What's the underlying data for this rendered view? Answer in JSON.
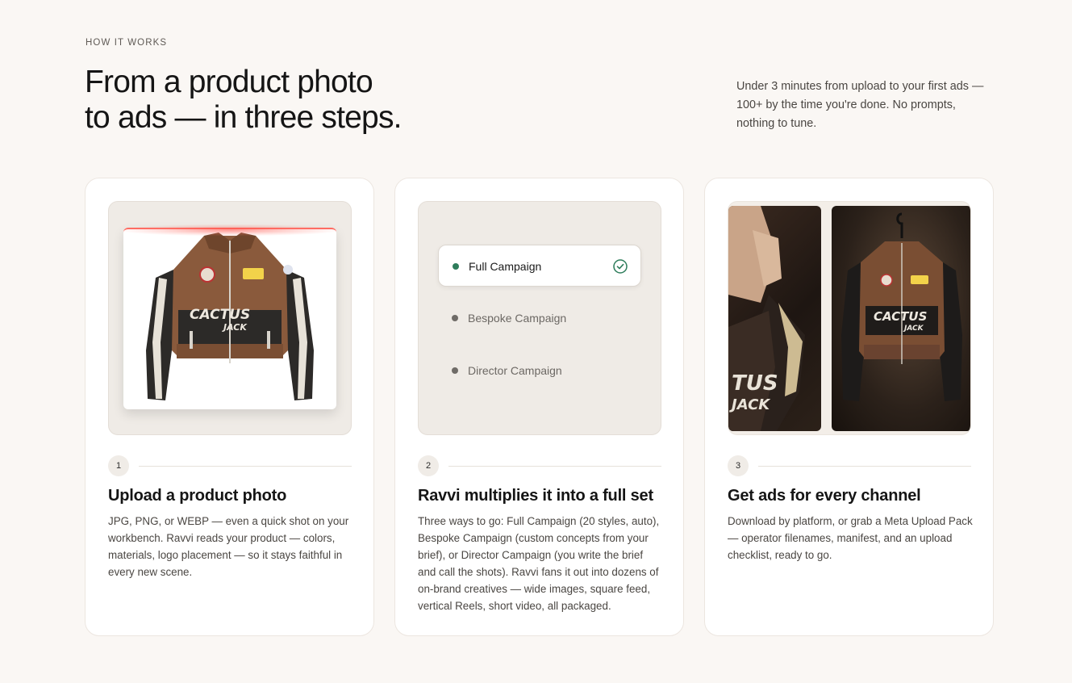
{
  "section": {
    "eyebrow": "HOW IT WORKS",
    "headline_line1": "From a product photo",
    "headline_line2": "to ads — in three steps.",
    "subcopy": "Under 3 minutes from upload to your first ads — 100+ by the time you're done. No prompts, nothing to tune."
  },
  "steps": [
    {
      "number": "1",
      "title": "Upload a product photo",
      "body": "JPG, PNG, or WEBP — even a quick shot on your workbench. Ravvi reads your product — colors, materials, logo placement — so it stays faithful in every new scene.",
      "visual": {
        "jacket_text_1": "CACTUS",
        "jacket_text_2": "JACK"
      }
    },
    {
      "number": "2",
      "title": "Ravvi multiplies it into a full set",
      "body": "Three ways to go: Full Campaign (20 styles, auto), Bespoke Campaign (custom concepts from your brief), or Director Campaign (you write the brief and call the shots). Ravvi fans it out into dozens of on-brand creatives — wide images, square feed, vertical Reels, short video, all packaged.",
      "options": [
        {
          "label": "Full Campaign",
          "selected": true
        },
        {
          "label": "Bespoke Campaign",
          "selected": false
        },
        {
          "label": "Director Campaign",
          "selected": false
        }
      ]
    },
    {
      "number": "3",
      "title": "Get ads for every channel",
      "body": "Download by platform, or grab a Meta Upload Pack — operator filenames, manifest, and an upload checklist, ready to go.",
      "visual": {
        "jacket_text_1": "CACTUS",
        "jacket_text_2": "JACK",
        "crop_text_1": "TUS",
        "crop_text_2": "JACK"
      }
    }
  ],
  "colors": {
    "background": "#faf7f4",
    "card": "#ffffff",
    "accent_green": "#2e7d5b",
    "scan_red": "#ff6b62",
    "jacket_brown": "#8a5a3c",
    "jacket_dark": "#2c2a28"
  },
  "icons": {
    "check": "check-circle-icon",
    "bullet": "dot-icon"
  }
}
